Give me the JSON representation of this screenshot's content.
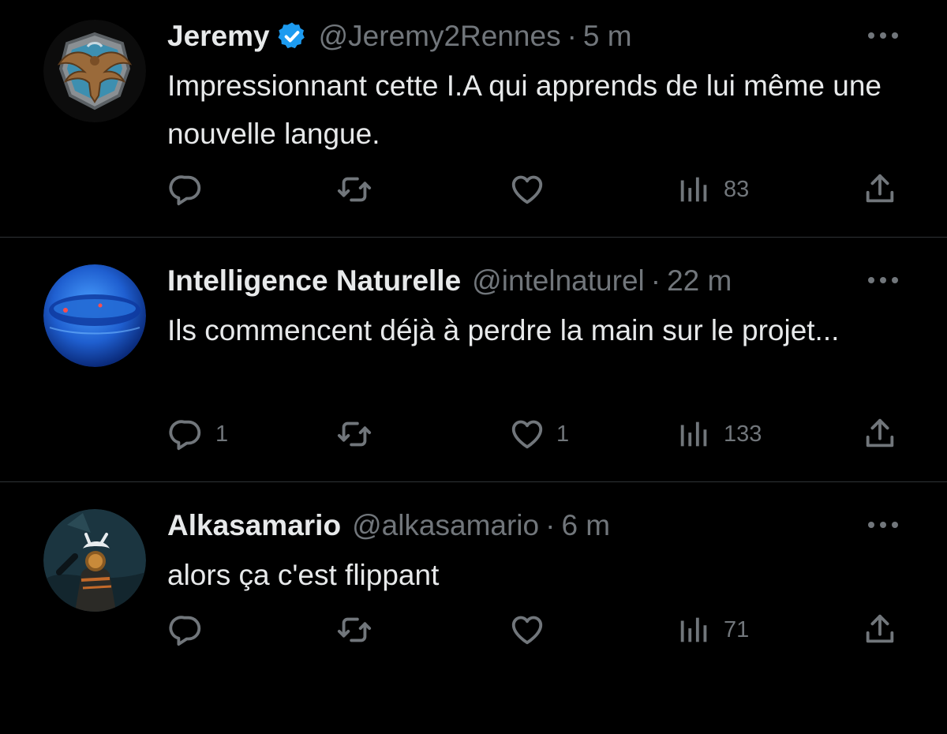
{
  "tweets": [
    {
      "display_name": "Jeremy",
      "verified": true,
      "handle": "@Jeremy2Rennes",
      "separator": "·",
      "time": "5 m",
      "text": "Impressionnant cette I.A qui apprends de lui même une nouvelle langue.",
      "avatar_icon": "eagle-crest-avatar",
      "reply_count": "",
      "like_count": "",
      "views_count": "83"
    },
    {
      "display_name": "Intelligence Naturelle",
      "verified": false,
      "handle": "@intelnaturel",
      "separator": "·",
      "time": "22 m",
      "text": "Ils commencent déjà à perdre la main sur le projet...",
      "avatar_icon": "blue-sphere-avatar",
      "reply_count": "1",
      "like_count": "1",
      "views_count": "133"
    },
    {
      "display_name": "Alkasamario",
      "verified": false,
      "handle": "@alkasamario",
      "separator": "·",
      "time": "6 m",
      "text": "alors ça c'est flippant",
      "avatar_icon": "character-avatar",
      "reply_count": "",
      "like_count": "",
      "views_count": "71"
    }
  ],
  "colors": {
    "background": "#000000",
    "primary_text": "#e7e9ea",
    "secondary_text": "#71767b",
    "divider": "#2f3336",
    "verified_badge": "#1d9bf0"
  }
}
